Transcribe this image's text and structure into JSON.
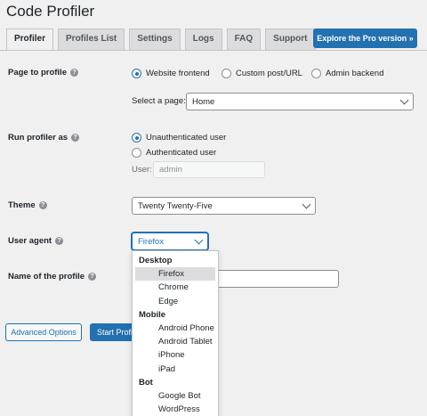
{
  "page": {
    "title": "Code Profiler"
  },
  "tabs": [
    {
      "label": "Profiler",
      "active": true
    },
    {
      "label": "Profiles List",
      "active": false
    },
    {
      "label": "Settings",
      "active": false
    },
    {
      "label": "Logs",
      "active": false
    },
    {
      "label": "FAQ",
      "active": false
    },
    {
      "label": "Support",
      "active": false
    }
  ],
  "pro_button": "Explore the Pro version »",
  "page_to_profile": {
    "label": "Page to profile",
    "options": [
      "Website frontend",
      "Custom post/URL",
      "Admin backend"
    ],
    "selected": "Website frontend",
    "select_label": "Select a page:",
    "select_value": "Home"
  },
  "run_as": {
    "label": "Run profiler as",
    "options": [
      "Unauthenticated user",
      "Authenticated user"
    ],
    "selected": "Unauthenticated user",
    "user_label": "User:",
    "user_placeholder": "admin"
  },
  "theme": {
    "label": "Theme",
    "value": "Twenty Twenty-Five"
  },
  "user_agent": {
    "label": "User agent",
    "value": "Firefox"
  },
  "profile_name": {
    "label": "Name of the profile",
    "value": ""
  },
  "buttons": {
    "advanced": "Advanced Options",
    "start": "Start Profiling"
  },
  "ua_dropdown": {
    "groups": [
      {
        "label": "Desktop",
        "options": [
          "Firefox",
          "Chrome",
          "Edge"
        ]
      },
      {
        "label": "Mobile",
        "options": [
          "Android Phone",
          "Android Tablet",
          "iPhone",
          "iPad"
        ]
      },
      {
        "label": "Bot",
        "options": [
          "Google Bot",
          "WordPress"
        ]
      }
    ],
    "selected": "Firefox"
  },
  "colors": {
    "accent": "#2271b1",
    "background": "#f0f0f1"
  }
}
